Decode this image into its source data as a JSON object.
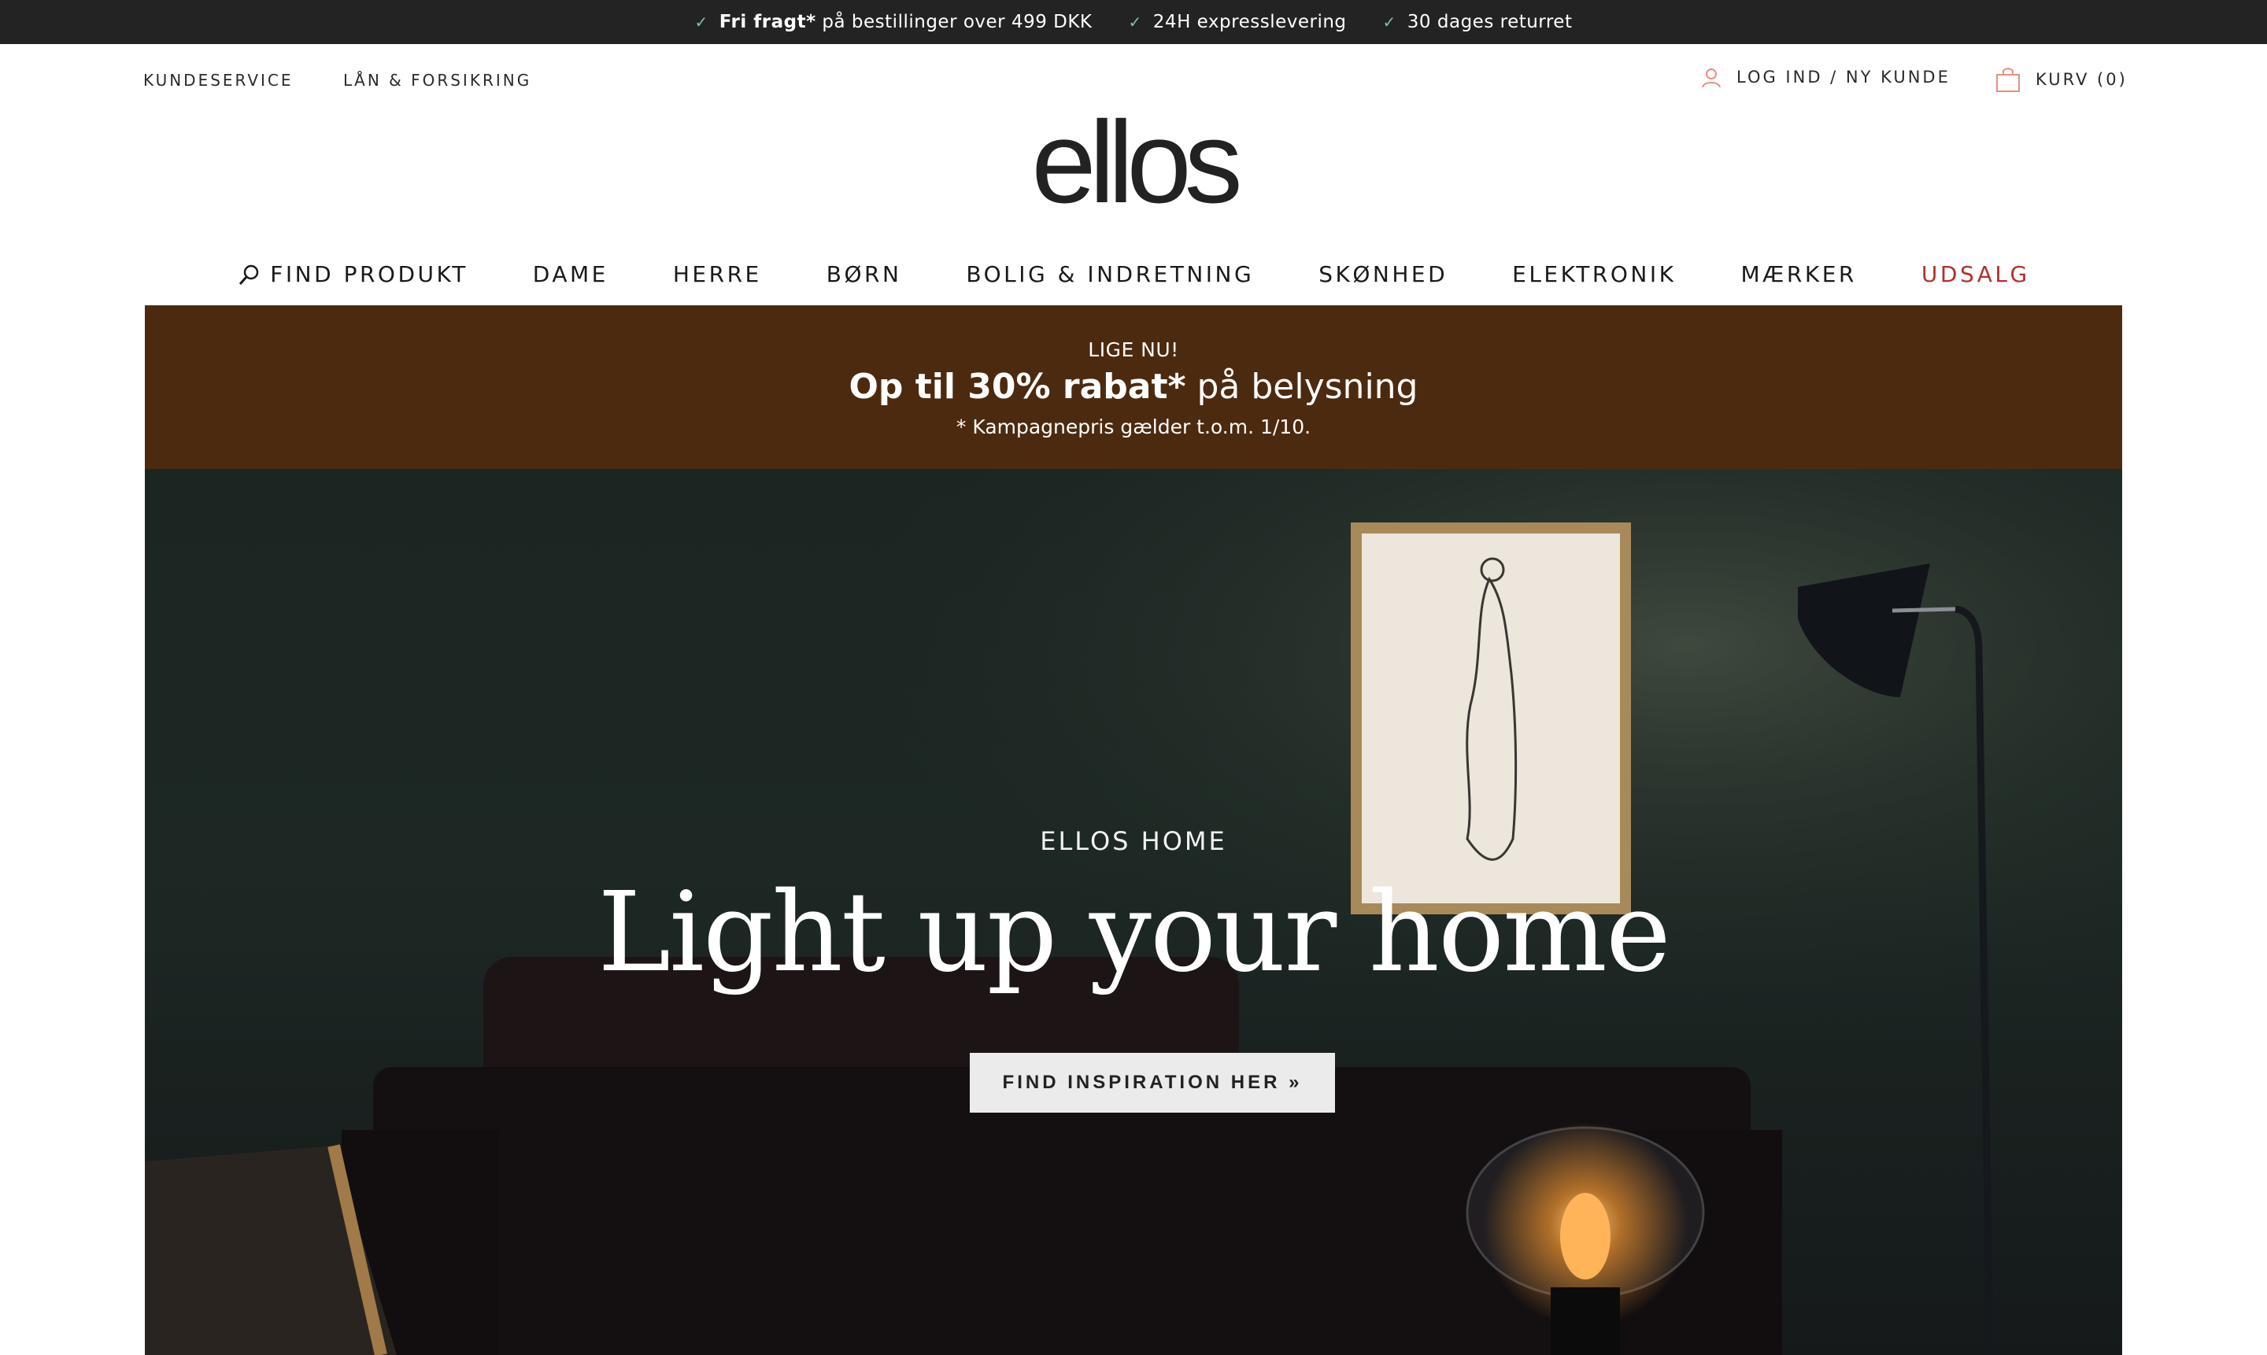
{
  "usp_bar": {
    "items": [
      {
        "strong": "Fri fragt*",
        "text": " på bestillinger over 499 DKK"
      },
      {
        "strong": "",
        "text": "24H expresslevering"
      },
      {
        "strong": "",
        "text": "30 dages returret"
      }
    ],
    "check_icon": "check-icon",
    "check_color": "#7fc2a0"
  },
  "utility": {
    "customer_service": "KUNDESERVICE",
    "loans": "LÅN & FORSIKRING",
    "login": "LOG IND / NY KUNDE",
    "cart": "KURV (0)",
    "accent_color": "#e8907a"
  },
  "logo": {
    "text": "ellos"
  },
  "nav": {
    "search_label": "FIND PRODUKT",
    "items": [
      "DAME",
      "HERRE",
      "BØRN",
      "BOLIG & INDRETNING",
      "SKØNHED",
      "ELEKTRONIK",
      "MÆRKER"
    ],
    "sale": "UDSALG",
    "sale_color": "#b2312b"
  },
  "promo": {
    "kicker": "LIGE NU!",
    "headline_strong": "Op til 30% rabat*",
    "headline_rest": " på belysning",
    "note": "* Kampagnepris gælder t.o.m. 1/10.",
    "background": "#4c2a10"
  },
  "hero": {
    "kicker": "ELLOS HOME",
    "title": "Light up your home",
    "cta": "FIND INSPIRATION HER  »"
  }
}
